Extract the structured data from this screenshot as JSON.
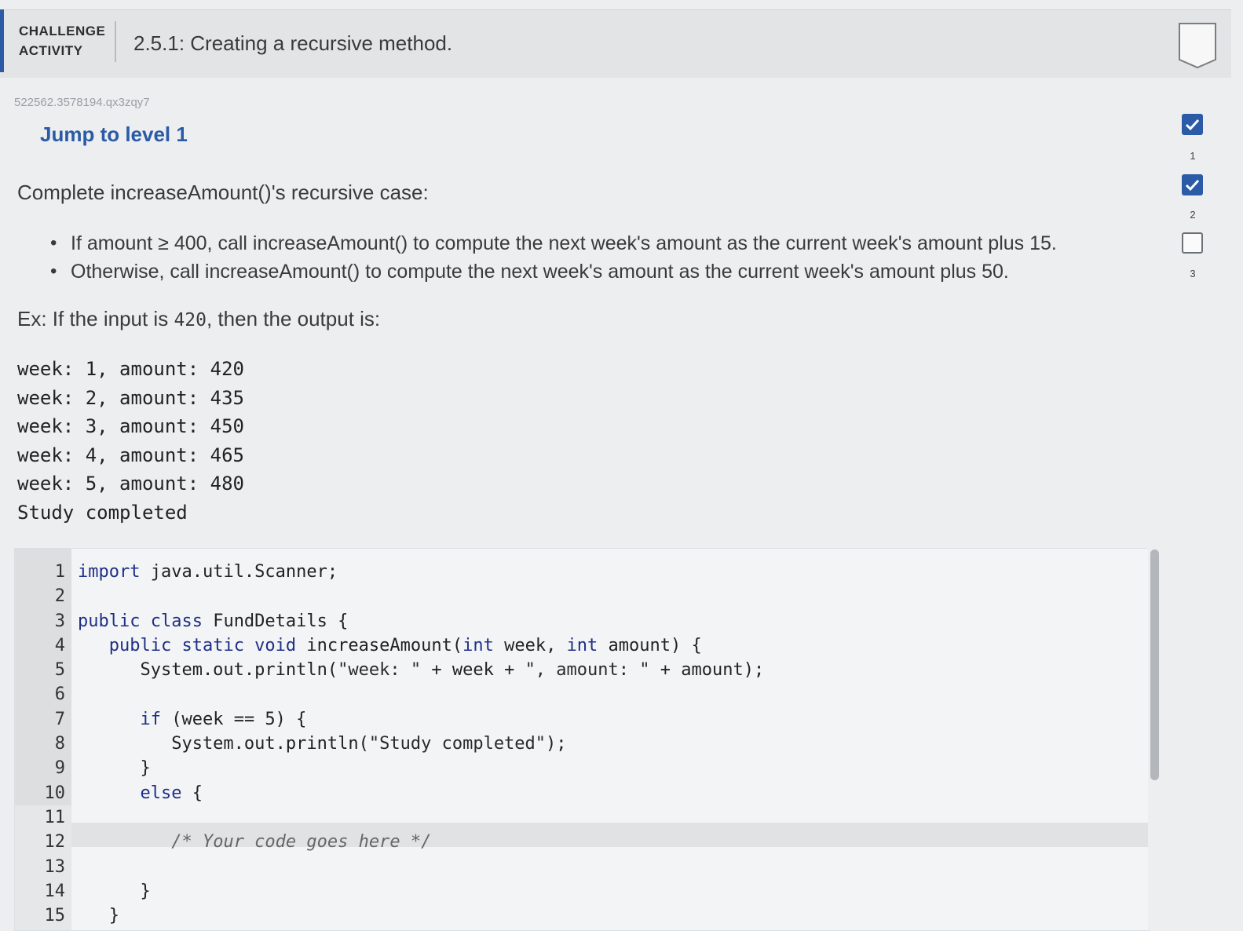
{
  "header": {
    "badge_line1": "CHALLENGE",
    "badge_line2": "ACTIVITY",
    "title": "2.5.1: Creating a recursive method."
  },
  "activity_id": "522562.3578194.qx3zqy7",
  "jump_link": "Jump to level 1",
  "instructions": {
    "prompt": "Complete increaseAmount()'s recursive case:",
    "bullets": [
      "If amount ≥ 400, call increaseAmount() to compute the next week's amount as the current week's amount plus 15.",
      "Otherwise, call increaseAmount() to compute the next week's amount as the current week's amount plus 50."
    ],
    "example_prefix": "Ex: If the input is ",
    "example_input": "420",
    "example_suffix": ", then the output is:"
  },
  "output_lines": [
    "week: 1, amount: 420",
    "week: 2, amount: 435",
    "week: 3, amount: 450",
    "week: 4, amount: 465",
    "week: 5, amount: 480",
    "Study completed"
  ],
  "editor": {
    "line_numbers": [
      "1",
      "2",
      "3",
      "4",
      "5",
      "6",
      "7",
      "8",
      "9",
      "10",
      "11",
      "12",
      "13",
      "14",
      "15"
    ]
  },
  "levels": [
    {
      "num": "1",
      "status": "done"
    },
    {
      "num": "2",
      "status": "done"
    },
    {
      "num": "3",
      "status": "todo"
    }
  ],
  "colors": {
    "accent": "#2b5aa6",
    "keyword": "#1f2f87"
  }
}
